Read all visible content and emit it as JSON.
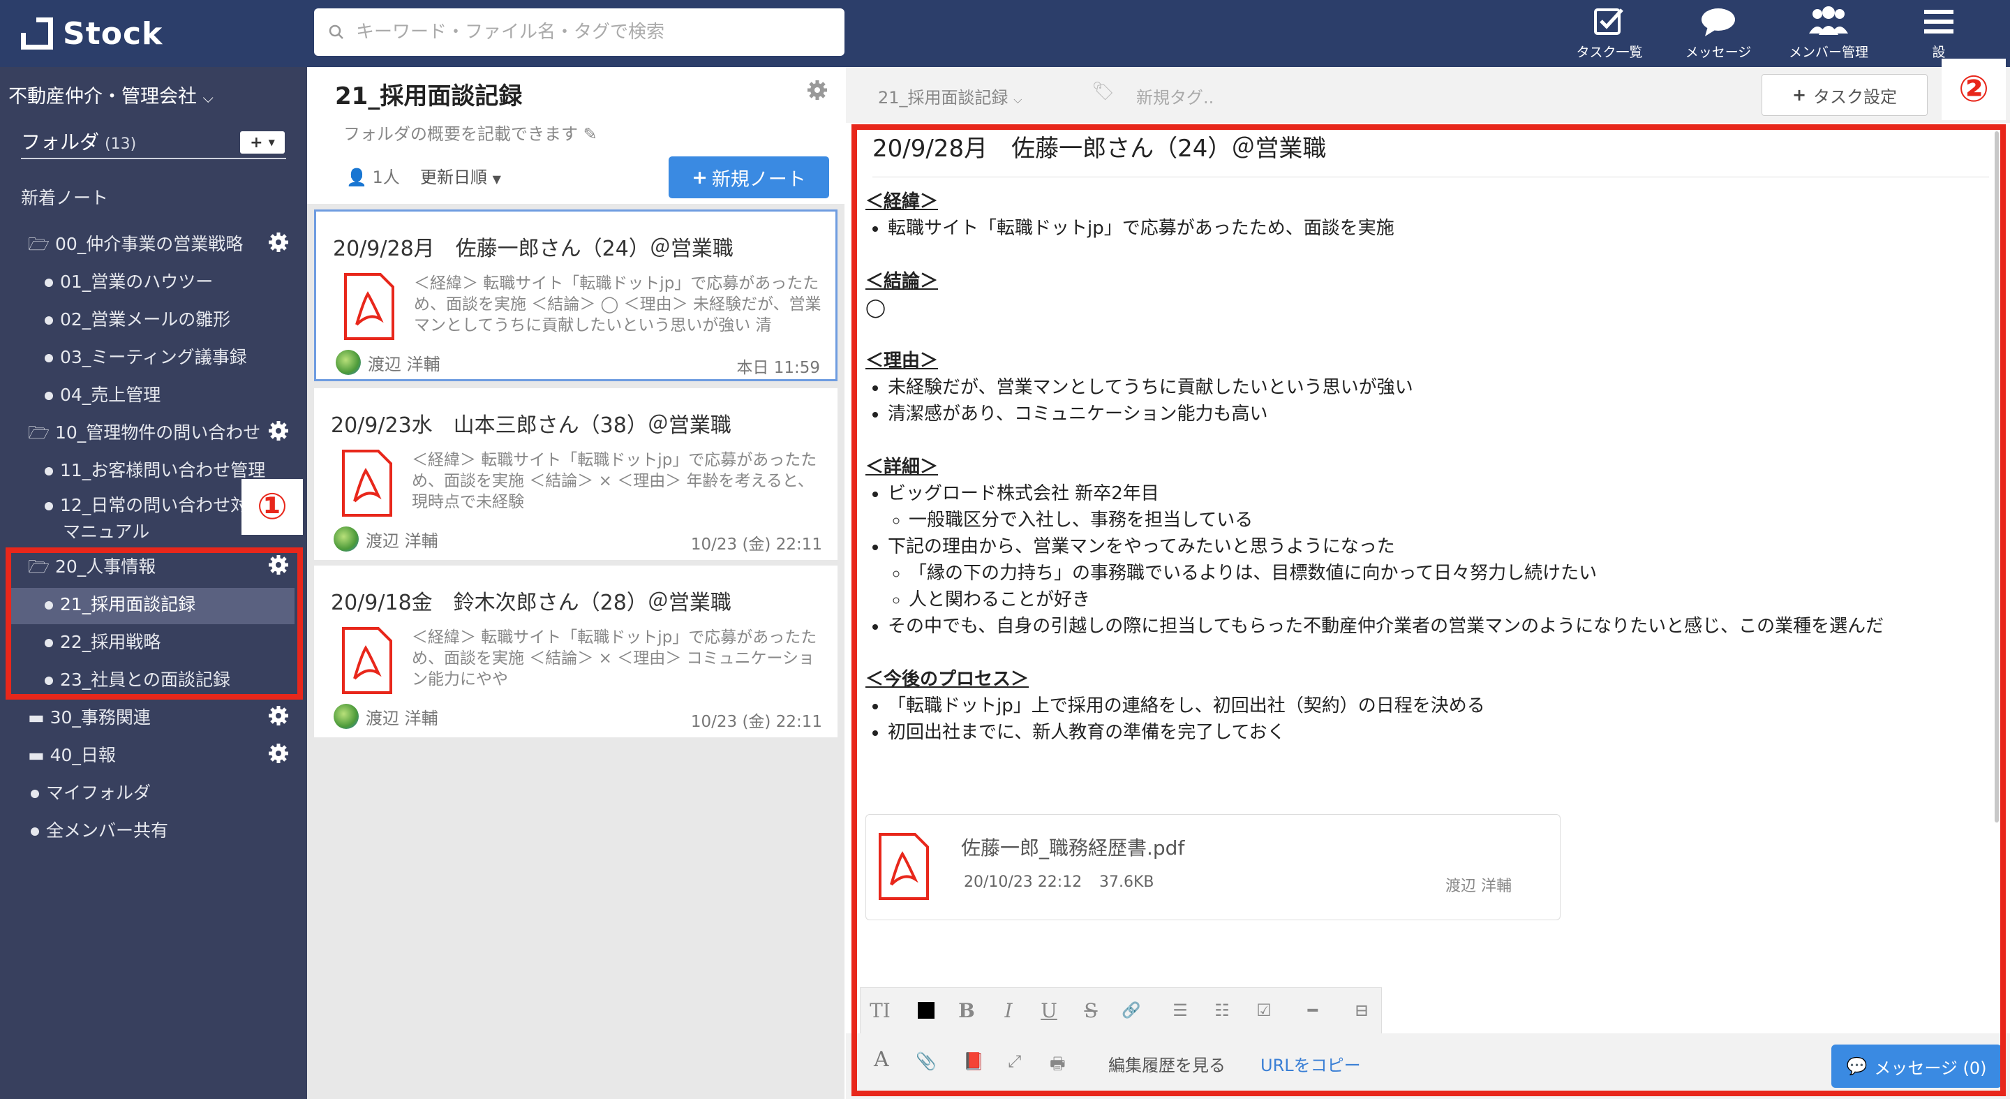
{
  "app": {
    "name": "Stock"
  },
  "search": {
    "placeholder": "キーワード・ファイル名・タグで検索"
  },
  "nav": [
    {
      "label": "タスク一覧",
      "icon": "task-check-icon"
    },
    {
      "label": "メッセージ",
      "icon": "chat-bubble-icon"
    },
    {
      "label": "メンバー管理",
      "icon": "members-icon"
    },
    {
      "label": "設",
      "icon": "menu-icon"
    }
  ],
  "sidebar": {
    "company": "不動産仲介・管理会社",
    "folder_label": "フォルダ",
    "folder_count": "(13)",
    "new_notes": "新着ノート",
    "folders": [
      {
        "label": "00_仲介事業の営業戦略"
      },
      {
        "label": "01_営業のハウツー"
      },
      {
        "label": "02_営業メールの雛形"
      },
      {
        "label": "03_ミーティング議事録"
      },
      {
        "label": "04_売上管理"
      },
      {
        "label": "10_管理物件の問い合わせ"
      },
      {
        "label": "11_お客様問い合わせ管理"
      },
      {
        "label": "12_日常の問い合わせ対応"
      },
      {
        "label": "マニュアル"
      },
      {
        "label": "20_人事情報"
      },
      {
        "label": "21_採用面談記録"
      },
      {
        "label": "22_採用戦略"
      },
      {
        "label": "23_社員との面談記録"
      },
      {
        "label": "30_事務関連"
      },
      {
        "label": "40_日報"
      },
      {
        "label": "マイフォルダ"
      },
      {
        "label": "全メンバー共有"
      }
    ]
  },
  "list": {
    "folder_title": "21_採用面談記録",
    "description": "フォルダの概要を記載できます",
    "members": "1人",
    "sort": "更新日順",
    "new_note": "新規ノート",
    "notes": [
      {
        "title": "20/9/28月　佐藤一郎さん（24）＠営業職",
        "body": "＜経緯＞ 転職サイト「転職ドットjp」で応募があったため、面談を実施 ＜結論＞ ◯ ＜理由＞ 未経験だが、営業マンとしてうちに貢献したいという思いが強い 清",
        "user": "渡辺 洋輔",
        "time": "本日 11:59"
      },
      {
        "title": "20/9/23水　山本三郎さん（38）＠営業職",
        "body": "＜経緯＞ 転職サイト「転職ドットjp」で応募があったため、面談を実施 ＜結論＞ × ＜理由＞ 年齢を考えると、現時点で未経験",
        "user": "渡辺 洋輔",
        "time": "10/23 (金) 22:11"
      },
      {
        "title": "20/9/18金　鈴木次郎さん（28）＠営業職",
        "body": "＜経緯＞ 転職サイト「転職ドットjp」で応募があったため、面談を実施 ＜結論＞ × ＜理由＞ コミュニケーション能力にやや",
        "user": "渡辺 洋輔",
        "time": "10/23 (金) 22:11"
      }
    ]
  },
  "editor": {
    "breadcrumb": "21_採用面談記録",
    "tag_placeholder": "新規タグ..",
    "task_button": "タスク設定",
    "title": "20/9/28月　佐藤一郎さん（24）＠営業職",
    "sections": {
      "h1": "＜経緯＞",
      "p1": "転職サイト「転職ドットjp」で応募があったため、面談を実施",
      "h2": "＜結論＞",
      "p2": "◯",
      "h3": "＜理由＞",
      "p3a": "未経験だが、営業マンとしてうちに貢献したいという思いが強い",
      "p3b": "清潔感があり、コミュニケーション能力も高い",
      "h4": "＜詳細＞",
      "p4a": "ビッグロード株式会社 新卒2年目",
      "p4a1": "一般職区分で入社し、事務を担当している",
      "p4b": "下記の理由から、営業マンをやってみたいと思うようになった",
      "p4b1": "「縁の下の力持ち」の事務職でいるよりは、目標数値に向かって日々努力し続けたい",
      "p4b2": "人と関わることが好き",
      "p4c": "その中でも、自身の引越しの際に担当してもらった不動産仲介業者の営業マンのようになりたいと感じ、この業種を選んだ",
      "h5": "＜今後のプロセス＞",
      "p5a": "「転職ドットjp」上で採用の連絡をし、初回出社（契約）の日程を決める",
      "p5b": "初回出社までに、新人教育の準備を完了しておく"
    },
    "attachment": {
      "name": "佐藤一郎_職務経歴書.pdf",
      "date": "20/10/23 22:12",
      "size": "37.6KB",
      "user": "渡辺 洋輔"
    },
    "history": "編集履歴を見る",
    "copy_url": "URLをコピー",
    "message_btn": "メッセージ (0)"
  },
  "annotations": {
    "one": "①",
    "two": "②"
  },
  "colors": {
    "topbar": "#2c3e6a",
    "sidebar": "#38405e",
    "accent": "#3a8ae2",
    "annotation": "#e8271b"
  }
}
